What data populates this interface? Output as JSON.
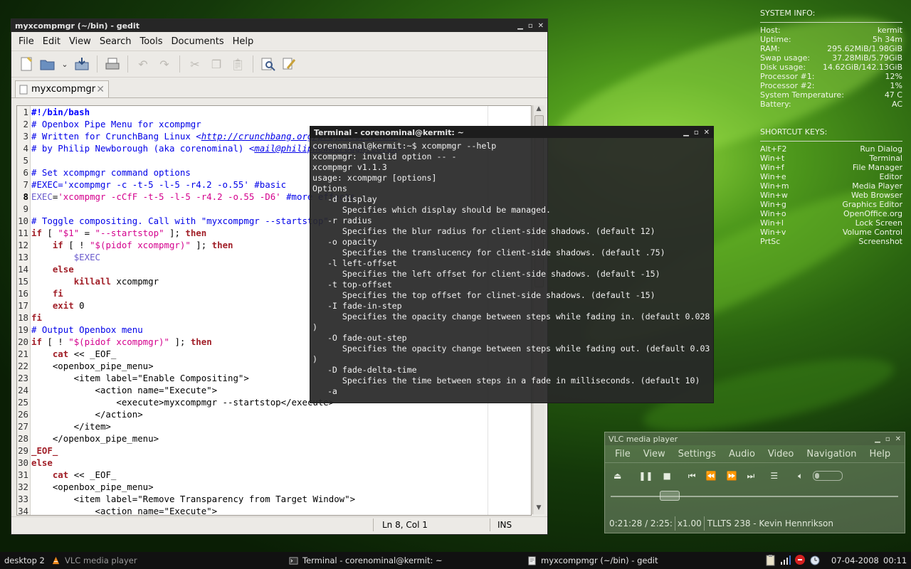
{
  "conky": {
    "sysinfo_header": "SYSTEM INFO:",
    "sysinfo": [
      {
        "label": "Host:",
        "value": "kermit"
      },
      {
        "label": "Uptime:",
        "value": "5h 34m"
      },
      {
        "label": "RAM:",
        "value": "295.62MiB/1.98GiB"
      },
      {
        "label": "Swap usage:",
        "value": "37.28MiB/5.79GiB"
      },
      {
        "label": "Disk usage:",
        "value": "14.62GiB/142.13GiB"
      },
      {
        "label": "Processor #1:",
        "value": "12%"
      },
      {
        "label": "Processor #2:",
        "value": "1%"
      },
      {
        "label": "System Temperature:",
        "value": "47 C"
      },
      {
        "label": "Battery:",
        "value": "AC"
      }
    ],
    "shortcuts_header": "SHORTCUT KEYS:",
    "shortcuts": [
      {
        "key": "Alt+F2",
        "action": "Run Dialog"
      },
      {
        "key": "Win+t",
        "action": "Terminal"
      },
      {
        "key": "Win+f",
        "action": "File Manager"
      },
      {
        "key": "Win+e",
        "action": "Editor"
      },
      {
        "key": "Win+m",
        "action": "Media Player"
      },
      {
        "key": "Win+w",
        "action": "Web Browser"
      },
      {
        "key": "Win+g",
        "action": "Graphics Editor"
      },
      {
        "key": "Win+o",
        "action": "OpenOffice.org"
      },
      {
        "key": "Win+l",
        "action": "Lock Screen"
      },
      {
        "key": "Win+v",
        "action": "Volume Control"
      },
      {
        "key": "PrtSc",
        "action": "Screenshot"
      }
    ]
  },
  "gedit": {
    "title": "myxcompmgr (~/bin) - gedit",
    "menu": [
      "File",
      "Edit",
      "View",
      "Search",
      "Tools",
      "Documents",
      "Help"
    ],
    "tab_label": "myxcompmgr",
    "status_pos": "Ln 8, Col 1",
    "status_mode": "INS",
    "lines": [
      {
        "n": "1",
        "parts": [
          [
            "sb",
            "#!/bin/bash"
          ]
        ]
      },
      {
        "n": "2",
        "parts": [
          [
            "cm",
            "# Openbox Pipe Menu for xcompmgr"
          ]
        ]
      },
      {
        "n": "3",
        "parts": [
          [
            "cm",
            "# Written for CrunchBang Linux <"
          ],
          [
            "cm ul",
            "http://crunchbang.org/projects/linux/"
          ],
          [
            "cm",
            ">"
          ]
        ]
      },
      {
        "n": "4",
        "parts": [
          [
            "cm",
            "# by Philip Newborough (aka corenominal) <"
          ],
          [
            "cm ul",
            "mail@philipnewborough.co.uk"
          ],
          [
            "cm",
            ">"
          ]
        ]
      },
      {
        "n": "5",
        "parts": []
      },
      {
        "n": "6",
        "parts": [
          [
            "cm",
            "# Set xcompmgr command options"
          ]
        ]
      },
      {
        "n": "7",
        "parts": [
          [
            "cm",
            "#EXEC='xcompmgr -c -t-5 -l-5 -r4.2 -o.55' #basic"
          ]
        ]
      },
      {
        "n": "8",
        "parts": [
          [
            "vr",
            "EXEC"
          ],
          [
            "tg",
            "="
          ],
          [
            "st",
            "'xcompmgr -cCfF -t-5 -l-5 -r4.2 -o.55 -D6'"
          ],
          [
            "tg",
            " "
          ],
          [
            "cm",
            "#more effects"
          ]
        ]
      },
      {
        "n": "9",
        "parts": []
      },
      {
        "n": "10",
        "parts": [
          [
            "cm",
            "# Toggle compositing. Call with \"myxcompmgr --startstop\""
          ]
        ]
      },
      {
        "n": "11",
        "parts": [
          [
            "kw",
            "if"
          ],
          [
            "tg",
            " [ "
          ],
          [
            "st",
            "\"$1\""
          ],
          [
            "tg",
            " = "
          ],
          [
            "st",
            "\"--startstop\""
          ],
          [
            "tg",
            " ]; "
          ],
          [
            "kw",
            "then"
          ]
        ]
      },
      {
        "n": "12",
        "parts": [
          [
            "tg",
            "    "
          ],
          [
            "kw",
            "if"
          ],
          [
            "tg",
            " [ ! "
          ],
          [
            "st",
            "\"$(pidof xcompmgr)\""
          ],
          [
            "tg",
            " ]; "
          ],
          [
            "kw",
            "then"
          ]
        ]
      },
      {
        "n": "13",
        "parts": [
          [
            "tg",
            "        "
          ],
          [
            "vr",
            "$EXEC"
          ]
        ]
      },
      {
        "n": "14",
        "parts": [
          [
            "tg",
            "    "
          ],
          [
            "kw",
            "else"
          ]
        ]
      },
      {
        "n": "15",
        "parts": [
          [
            "tg",
            "        "
          ],
          [
            "kw",
            "killall"
          ],
          [
            "tg",
            " xcompmgr"
          ]
        ]
      },
      {
        "n": "16",
        "parts": [
          [
            "tg",
            "    "
          ],
          [
            "kw",
            "fi"
          ]
        ]
      },
      {
        "n": "17",
        "parts": [
          [
            "tg",
            "    "
          ],
          [
            "kw",
            "exit"
          ],
          [
            "tg",
            " 0"
          ]
        ]
      },
      {
        "n": "18",
        "parts": [
          [
            "kw",
            "fi"
          ]
        ]
      },
      {
        "n": "19",
        "parts": [
          [
            "cm",
            "# Output Openbox menu"
          ]
        ]
      },
      {
        "n": "20",
        "parts": [
          [
            "kw",
            "if"
          ],
          [
            "tg",
            " [ ! "
          ],
          [
            "st",
            "\"$(pidof xcompmgr)\""
          ],
          [
            "tg",
            " ]; "
          ],
          [
            "kw",
            "then"
          ]
        ]
      },
      {
        "n": "21",
        "parts": [
          [
            "tg",
            "    "
          ],
          [
            "kw",
            "cat"
          ],
          [
            "tg",
            " << _EOF_"
          ]
        ]
      },
      {
        "n": "22",
        "parts": [
          [
            "tg",
            "    <openbox_pipe_menu>"
          ]
        ]
      },
      {
        "n": "23",
        "parts": [
          [
            "tg",
            "        <item label=\"Enable Compositing\">"
          ]
        ]
      },
      {
        "n": "24",
        "parts": [
          [
            "tg",
            "            <action name=\"Execute\">"
          ]
        ]
      },
      {
        "n": "25",
        "parts": [
          [
            "tg",
            "                <execute>myxcompmgr --startstop</execute>"
          ]
        ]
      },
      {
        "n": "26",
        "parts": [
          [
            "tg",
            "            </action>"
          ]
        ]
      },
      {
        "n": "27",
        "parts": [
          [
            "tg",
            "        </item>"
          ]
        ]
      },
      {
        "n": "28",
        "parts": [
          [
            "tg",
            "    </openbox_pipe_menu>"
          ]
        ]
      },
      {
        "n": "29",
        "parts": [
          [
            "kw",
            "_EOF_"
          ]
        ]
      },
      {
        "n": "30",
        "parts": [
          [
            "kw",
            "else"
          ]
        ]
      },
      {
        "n": "31",
        "parts": [
          [
            "tg",
            "    "
          ],
          [
            "kw",
            "cat"
          ],
          [
            "tg",
            " << _EOF_"
          ]
        ]
      },
      {
        "n": "32",
        "parts": [
          [
            "tg",
            "    <openbox_pipe_menu>"
          ]
        ]
      },
      {
        "n": "33",
        "parts": [
          [
            "tg",
            "        <item label=\"Remove Transparency from Target Window\">"
          ]
        ]
      },
      {
        "n": "34",
        "parts": [
          [
            "tg",
            "            <action name=\"Execute\">"
          ]
        ]
      }
    ]
  },
  "terminal": {
    "title": "Terminal - corenominal@kermit: ~",
    "output": "corenominal@kermit:~$ xcompmgr --help\nxcompmgr: invalid option -- -\nxcompmgr v1.1.3\nusage: xcompmgr [options]\nOptions\n   -d display\n      Specifies which display should be managed.\n   -r radius\n      Specifies the blur radius for client-side shadows. (default 12)\n   -o opacity\n      Specifies the translucency for client-side shadows. (default .75)\n   -l left-offset\n      Specifies the left offset for client-side shadows. (default -15)\n   -t top-offset\n      Specifies the top offset for clinet-side shadows. (default -15)\n   -I fade-in-step\n      Specifies the opacity change between steps while fading in. (default 0.028\n)\n   -O fade-out-step\n      Specifies the opacity change between steps while fading out. (default 0.03\n)\n   -D fade-delta-time\n      Specifies the time between steps in a fade in milliseconds. (default 10)\n   -a"
  },
  "vlc": {
    "title": "VLC media player",
    "menu": [
      "File",
      "View",
      "Settings",
      "Audio",
      "Video",
      "Navigation",
      "Help"
    ],
    "seek_fraction": 0.17,
    "time": "0:21:28 / 2:25:",
    "speed": "x1.00",
    "now_playing": "TLLTS 238 -  Kevin Hennrikson"
  },
  "taskbar": {
    "desktop": "desktop 2",
    "tasks": [
      "VLC media player",
      "Terminal - corenominal@kermit: ~",
      "myxcompmgr (~/bin) - gedit"
    ],
    "date": "07-04-2008",
    "time": "00:11"
  }
}
